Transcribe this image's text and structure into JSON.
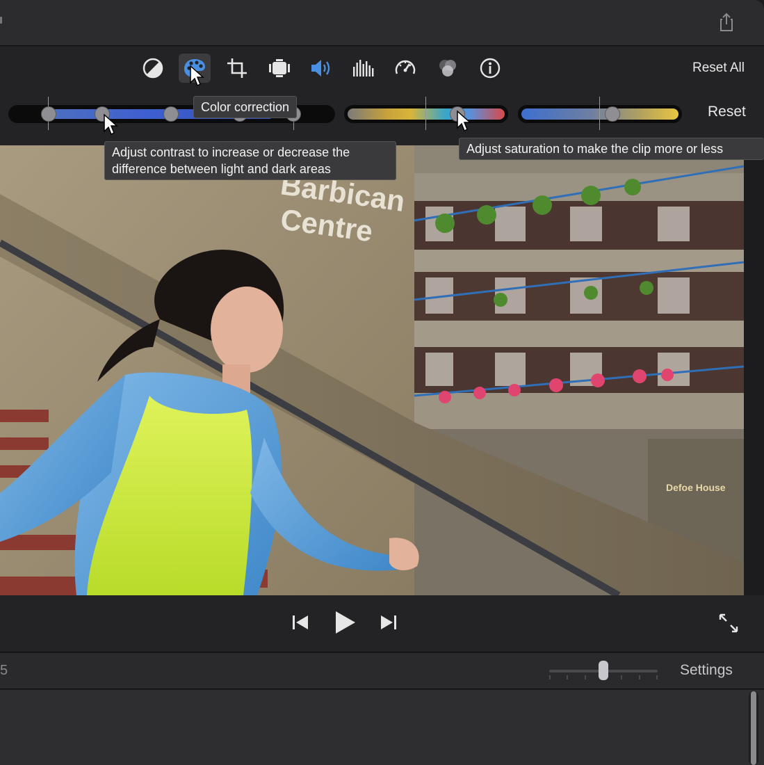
{
  "toolbar": {
    "tools": [
      {
        "name": "color-balance-icon",
        "selected": false
      },
      {
        "name": "color-correction-icon",
        "selected": true
      },
      {
        "name": "crop-icon",
        "selected": false
      },
      {
        "name": "stabilization-icon",
        "selected": false
      },
      {
        "name": "volume-icon",
        "selected": false
      },
      {
        "name": "noise-reduction-equalizer-icon",
        "selected": false
      },
      {
        "name": "speed-icon",
        "selected": false
      },
      {
        "name": "clip-filter-icon",
        "selected": false
      },
      {
        "name": "info-icon",
        "selected": false
      }
    ],
    "reset_all_label": "Reset All",
    "accent_color": "#4a90e2"
  },
  "adjust": {
    "reset_label": "Reset",
    "tooltip_tool": "Color correction",
    "tooltip_contrast": "Adjust contrast to increase or decrease the difference between light and dark areas",
    "tooltip_saturation": "Adjust saturation to make the clip more or less",
    "saturation_level": 0.7,
    "temperature_level": 0.58
  },
  "viewer": {
    "sign_text": "Barbican Centre",
    "sign_line1": "Barbican",
    "sign_line2": "Centre",
    "house_label": "Defoe House"
  },
  "transport": {
    "icons": [
      "skip-back-icon",
      "play-icon",
      "skip-forward-icon",
      "fullscreen-icon"
    ]
  },
  "timeline_header": {
    "timecode_fragment": "5",
    "settings_label": "Settings",
    "zoom_level": 0.5
  }
}
